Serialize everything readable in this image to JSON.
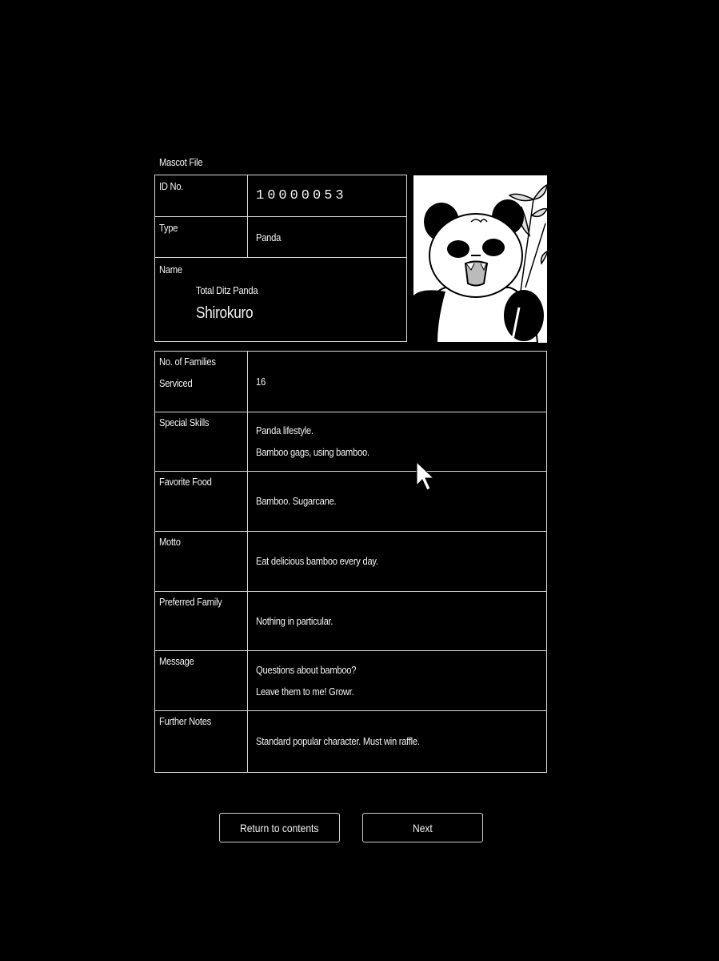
{
  "header": {
    "title": "Mascot File"
  },
  "profile": {
    "id_label": "ID No.",
    "id_value": "10000053",
    "type_label": "Type",
    "type_value": "Panda",
    "name_label": "Name",
    "name_subtitle": "Total Ditz Panda",
    "name_value": "Shirokuro",
    "portrait_icon": "panda-portrait"
  },
  "details": [
    {
      "label_lines": [
        "No. of Families",
        "Serviced"
      ],
      "value_lines": [
        "16"
      ]
    },
    {
      "label_lines": [
        "Special Skills"
      ],
      "value_lines": [
        "Panda lifestyle.",
        "Bamboo gags, using bamboo."
      ]
    },
    {
      "label_lines": [
        "Favorite Food"
      ],
      "value_lines": [
        "Bamboo. Sugarcane."
      ]
    },
    {
      "label_lines": [
        "Motto"
      ],
      "value_lines": [
        "Eat delicious bamboo every day."
      ]
    },
    {
      "label_lines": [
        "Preferred Family"
      ],
      "value_lines": [
        "Nothing in particular."
      ]
    },
    {
      "label_lines": [
        "Message"
      ],
      "value_lines": [
        "Questions about bamboo?",
        "Leave them to me!  Growr."
      ]
    },
    {
      "label_lines": [
        "Further Notes"
      ],
      "value_lines": [
        "Standard popular character.  Must win raffle."
      ]
    }
  ],
  "buttons": {
    "return_label": "Return to contents",
    "next_label": "Next"
  },
  "colors": {
    "background": "#000000",
    "foreground": "#f2f2f2",
    "border": "#d8d8d8"
  }
}
